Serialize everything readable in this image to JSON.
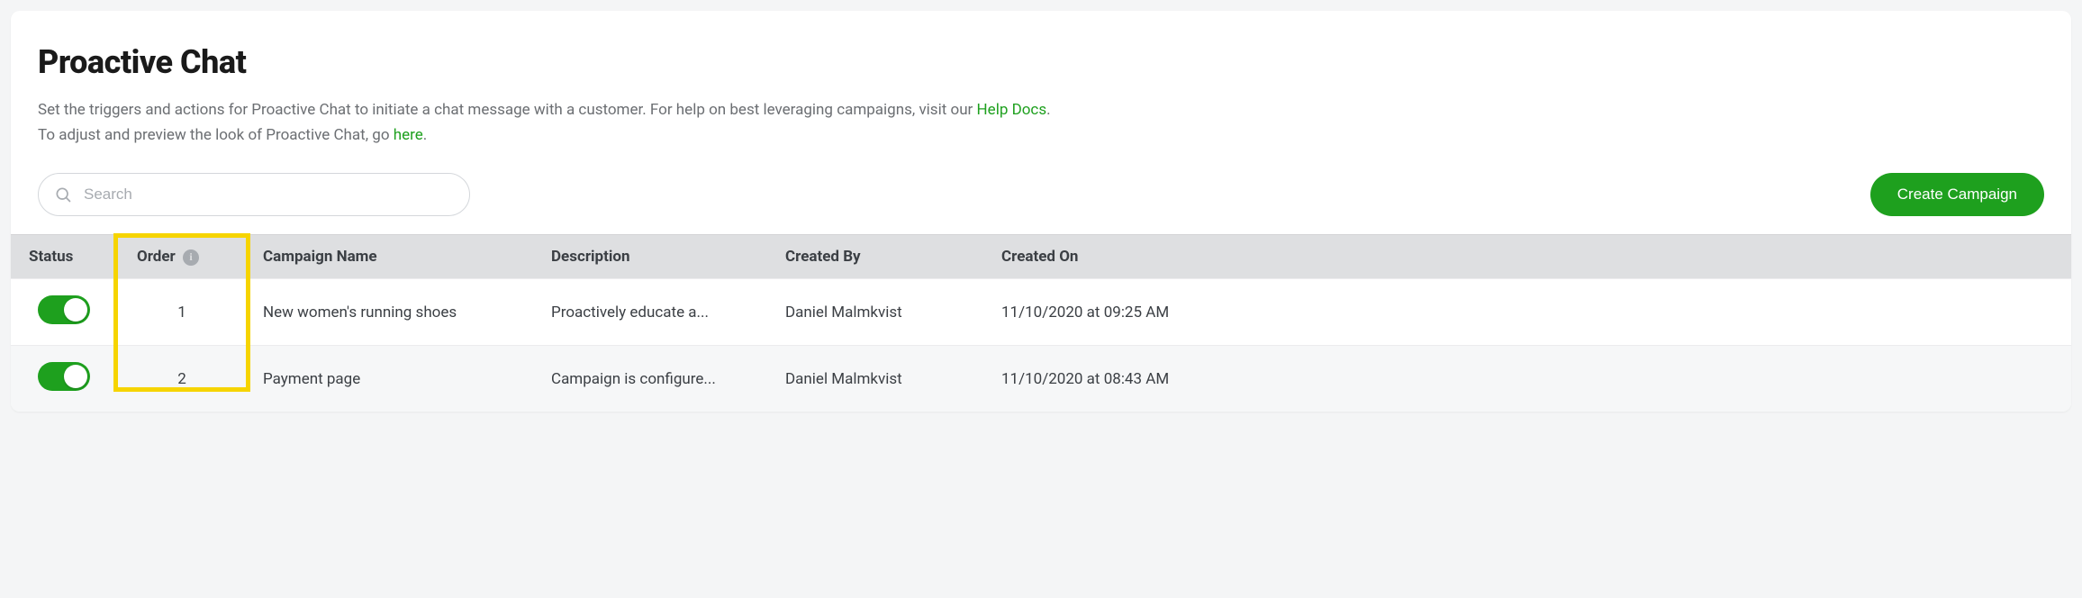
{
  "page": {
    "title": "Proactive Chat",
    "sub_before_help": "Set the triggers and actions for Proactive Chat to initiate a chat message with a customer. For help on best leveraging campaigns, visit our ",
    "help_link": "Help Docs",
    "sub_after_help": ".",
    "sub_line2_before": "To adjust and preview the look of Proactive Chat, go ",
    "here_link": "here",
    "sub_line2_after": "."
  },
  "controls": {
    "search_placeholder": "Search",
    "create_label": "Create Campaign"
  },
  "table": {
    "headers": {
      "status": "Status",
      "order": "Order",
      "name": "Campaign Name",
      "desc": "Description",
      "by": "Created By",
      "on": "Created On"
    },
    "rows": [
      {
        "enabled": true,
        "order": "1",
        "name": "New women's running shoes",
        "desc": "Proactively educate a...",
        "by": "Daniel Malmkvist",
        "on": "11/10/2020 at 09:25 AM"
      },
      {
        "enabled": true,
        "order": "2",
        "name": "Payment page",
        "desc": "Campaign is configure...",
        "by": "Daniel Malmkvist",
        "on": "11/10/2020 at 08:43 AM"
      }
    ]
  }
}
